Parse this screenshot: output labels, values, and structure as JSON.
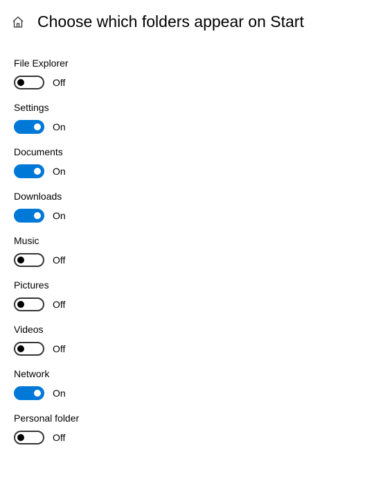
{
  "title": "Choose which folders appear on Start",
  "stateLabels": {
    "on": "On",
    "off": "Off"
  },
  "colors": {
    "accent": "#0078d7"
  },
  "settings": [
    {
      "key": "file-explorer",
      "label": "File Explorer",
      "on": false
    },
    {
      "key": "settings",
      "label": "Settings",
      "on": true
    },
    {
      "key": "documents",
      "label": "Documents",
      "on": true
    },
    {
      "key": "downloads",
      "label": "Downloads",
      "on": true
    },
    {
      "key": "music",
      "label": "Music",
      "on": false
    },
    {
      "key": "pictures",
      "label": "Pictures",
      "on": false
    },
    {
      "key": "videos",
      "label": "Videos",
      "on": false
    },
    {
      "key": "network",
      "label": "Network",
      "on": true
    },
    {
      "key": "personal-folder",
      "label": "Personal folder",
      "on": false
    }
  ]
}
